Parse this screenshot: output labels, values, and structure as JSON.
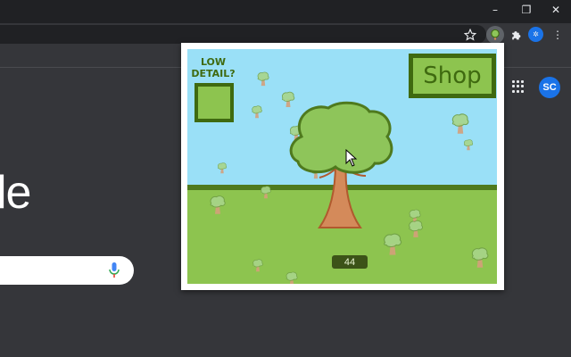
{
  "browser": {
    "window_controls": {
      "minimize": "–",
      "restore": "❐",
      "close": "✕"
    },
    "toolbar_icons": [
      "star-icon",
      "tree-extension-icon",
      "puzzle-icon",
      "profile-avatar",
      "menu-icon"
    ]
  },
  "new_tab_page": {
    "logo_fragment": "le",
    "apps_icon": "apps-grid-icon",
    "avatar_initials": "SC"
  },
  "game": {
    "low_detail_label": "LOW DETAIL?",
    "shop_label": "Shop",
    "score": "44",
    "colors": {
      "sky": "#9ae0f7",
      "grass": "#8dc44f",
      "dark_green": "#3f6a10",
      "trunk": "#d48a5a",
      "canopy": "#8ec55a"
    }
  }
}
